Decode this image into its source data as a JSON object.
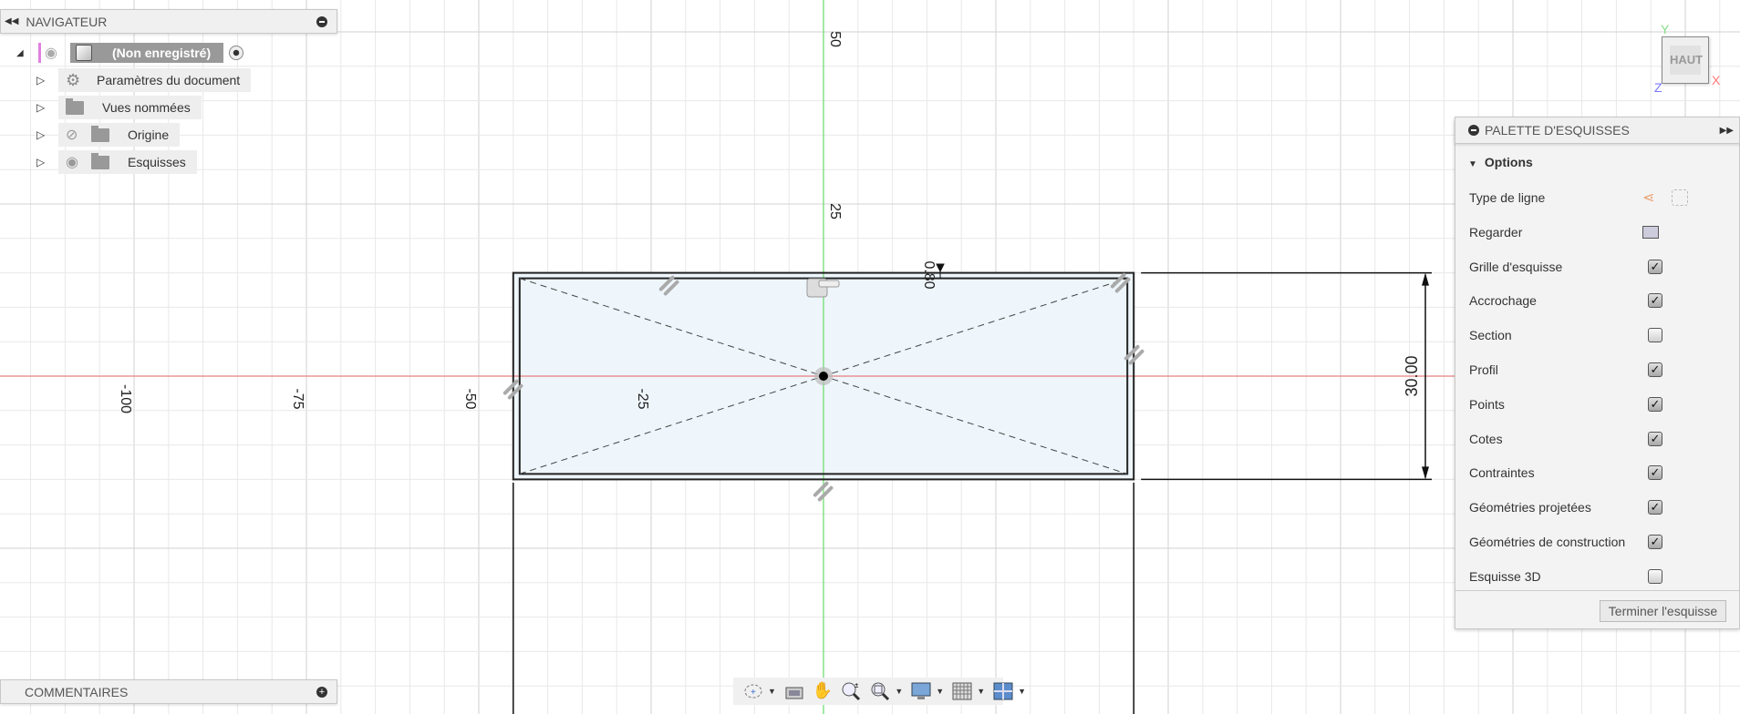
{
  "navigator": {
    "title": "NAVIGATEUR",
    "root": "(Non enregistré)",
    "items": [
      {
        "label": "Paramètres du document",
        "icon": "gear-icon"
      },
      {
        "label": "Vues nommées",
        "icon": "folder-icon"
      },
      {
        "label": "Origine",
        "icon": "folder-icon",
        "visibility": "hidden"
      },
      {
        "label": "Esquisses",
        "icon": "folder-icon",
        "visibility": "visible"
      }
    ]
  },
  "comments": {
    "title": "COMMENTAIRES"
  },
  "viewcube": {
    "face": "HAUT",
    "x": "X",
    "y": "Y",
    "z": "Z"
  },
  "sketch": {
    "x_ticks": [
      "-100",
      "-75",
      "-50",
      "-25"
    ],
    "y_ticks": [
      "50",
      "25"
    ],
    "dimension_height": "30.00",
    "dimension_offset": "0.80",
    "rect_units": {
      "x": [
        -45,
        45
      ],
      "y": [
        -15,
        15
      ]
    },
    "colors": {
      "x_axis": "#e88080",
      "y_axis": "#66dd66",
      "profile_fill": "#eef6fc"
    }
  },
  "palette": {
    "title": "PALETTE D'ESQUISSES",
    "section": "Options",
    "rows": [
      {
        "label": "Type de ligne",
        "kind": "icons"
      },
      {
        "label": "Regarder",
        "kind": "look-at"
      },
      {
        "label": "Grille d'esquisse",
        "checked": true
      },
      {
        "label": "Accrochage",
        "checked": true
      },
      {
        "label": "Section",
        "checked": false
      },
      {
        "label": "Profil",
        "checked": true
      },
      {
        "label": "Points",
        "checked": true
      },
      {
        "label": "Cotes",
        "checked": true
      },
      {
        "label": "Contraintes",
        "checked": true
      },
      {
        "label": "Géométries projetées",
        "checked": true
      },
      {
        "label": "Géométries de construction",
        "checked": true
      },
      {
        "label": "Esquisse 3D",
        "checked": false
      }
    ],
    "finish_button": "Terminer l'esquisse"
  },
  "toolbar": {
    "items": [
      "orbit-icon",
      "look-at-icon",
      "pan-icon",
      "zoom-icon",
      "zoom-window-icon",
      "display-icon",
      "grid-icon",
      "viewports-icon"
    ]
  }
}
